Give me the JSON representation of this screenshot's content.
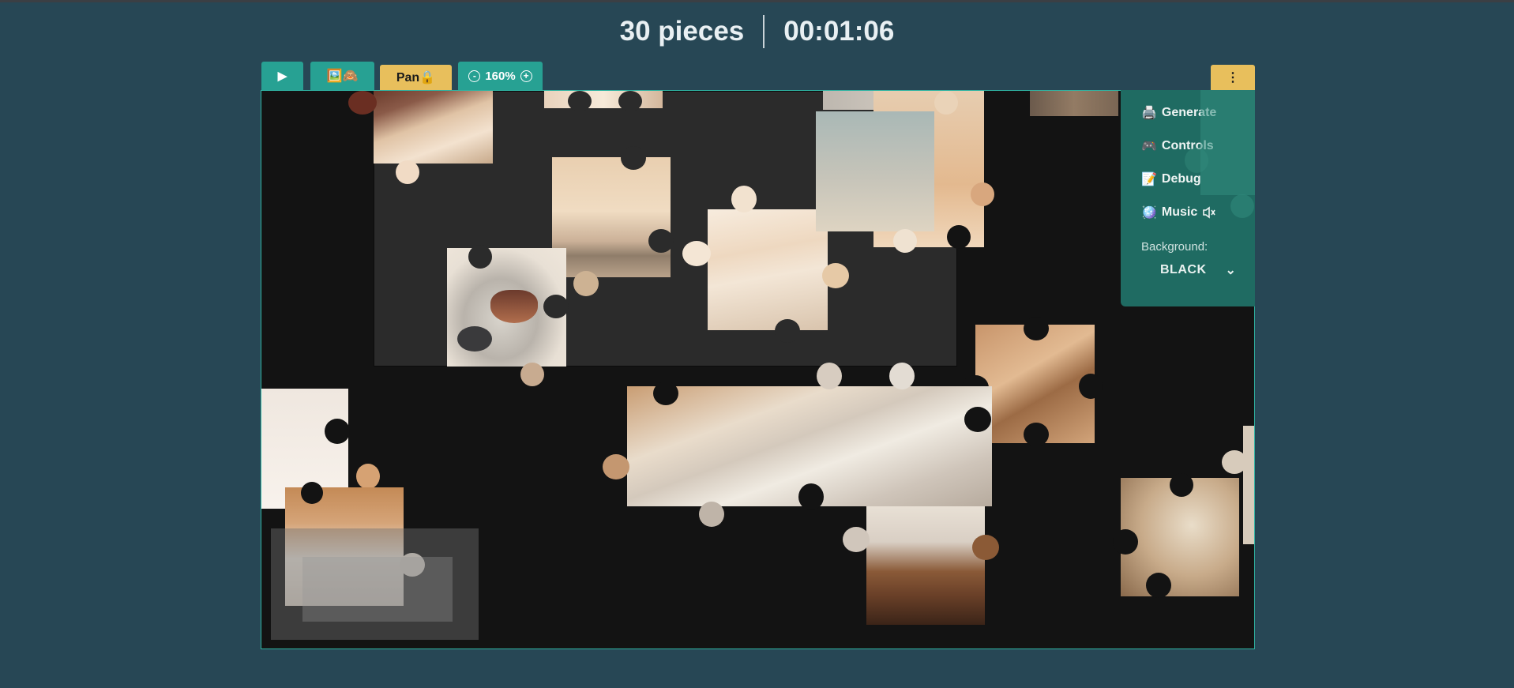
{
  "header": {
    "piece_count": "30 pieces",
    "timer": "00:01:06"
  },
  "toolbar": {
    "play_icon": "▶",
    "preview_icon": "🖼️🙈",
    "pan_label": "Pan🔒",
    "zoom_out_icon": "-",
    "zoom_level": "160%",
    "zoom_in_icon": "+",
    "more_icon": "⋮"
  },
  "menu": {
    "items": [
      {
        "icon": "🖨️",
        "label": "Generate"
      },
      {
        "icon": "🎮",
        "label": "Controls"
      },
      {
        "icon": "📝",
        "label": "Debug"
      },
      {
        "icon": "🪩",
        "label": "Music",
        "extra_icon": "speaker-muted-icon"
      }
    ],
    "background_label": "Background:",
    "background_value": "BLACK",
    "dropdown_icon": "⌄"
  },
  "colors": {
    "page_bg": "#274755",
    "teal": "#27a193",
    "gold": "#e8bf5c",
    "board_bg": "#131313",
    "menu_bg": "#1f6b62"
  }
}
